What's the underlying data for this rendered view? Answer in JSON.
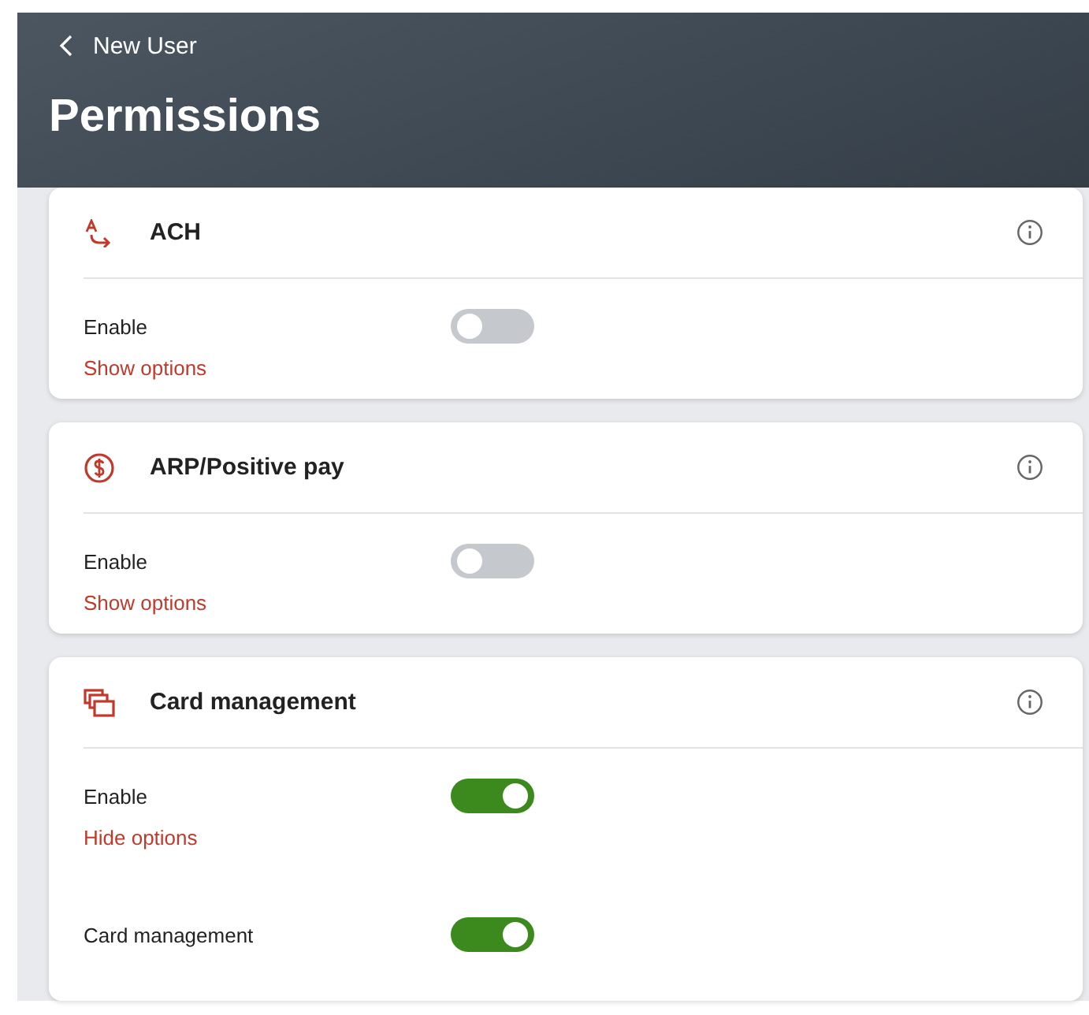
{
  "header": {
    "back_label": "New User",
    "title": "Permissions"
  },
  "permissions": [
    {
      "kind": "ach",
      "title": "ACH",
      "enable_label": "Enable",
      "enabled": false,
      "options_link": "Show options"
    },
    {
      "kind": "positive_pay",
      "title": "ARP/Positive pay",
      "enable_label": "Enable",
      "enabled": false,
      "options_link": "Show options"
    },
    {
      "kind": "cards",
      "title": "Card management",
      "enable_label": "Enable",
      "enabled": true,
      "options_link": "Hide options",
      "options": [
        {
          "label": "Card management",
          "on": true
        }
      ]
    }
  ]
}
